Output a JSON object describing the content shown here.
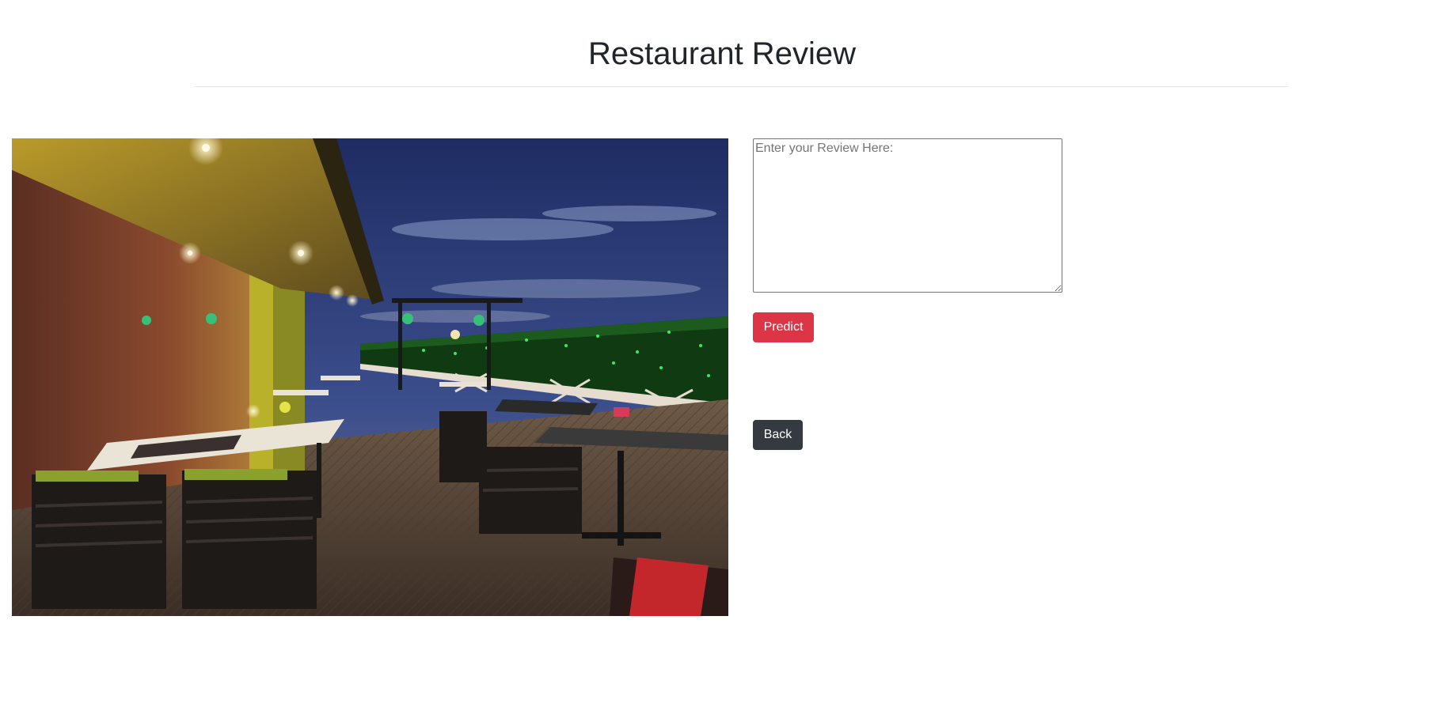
{
  "page": {
    "title": "Restaurant Review"
  },
  "review": {
    "placeholder": "Enter your Review Here:",
    "value": ""
  },
  "buttons": {
    "predict_label": "Predict",
    "back_label": "Back"
  },
  "colors": {
    "predict": "#dc3545",
    "back": "#343a40"
  }
}
